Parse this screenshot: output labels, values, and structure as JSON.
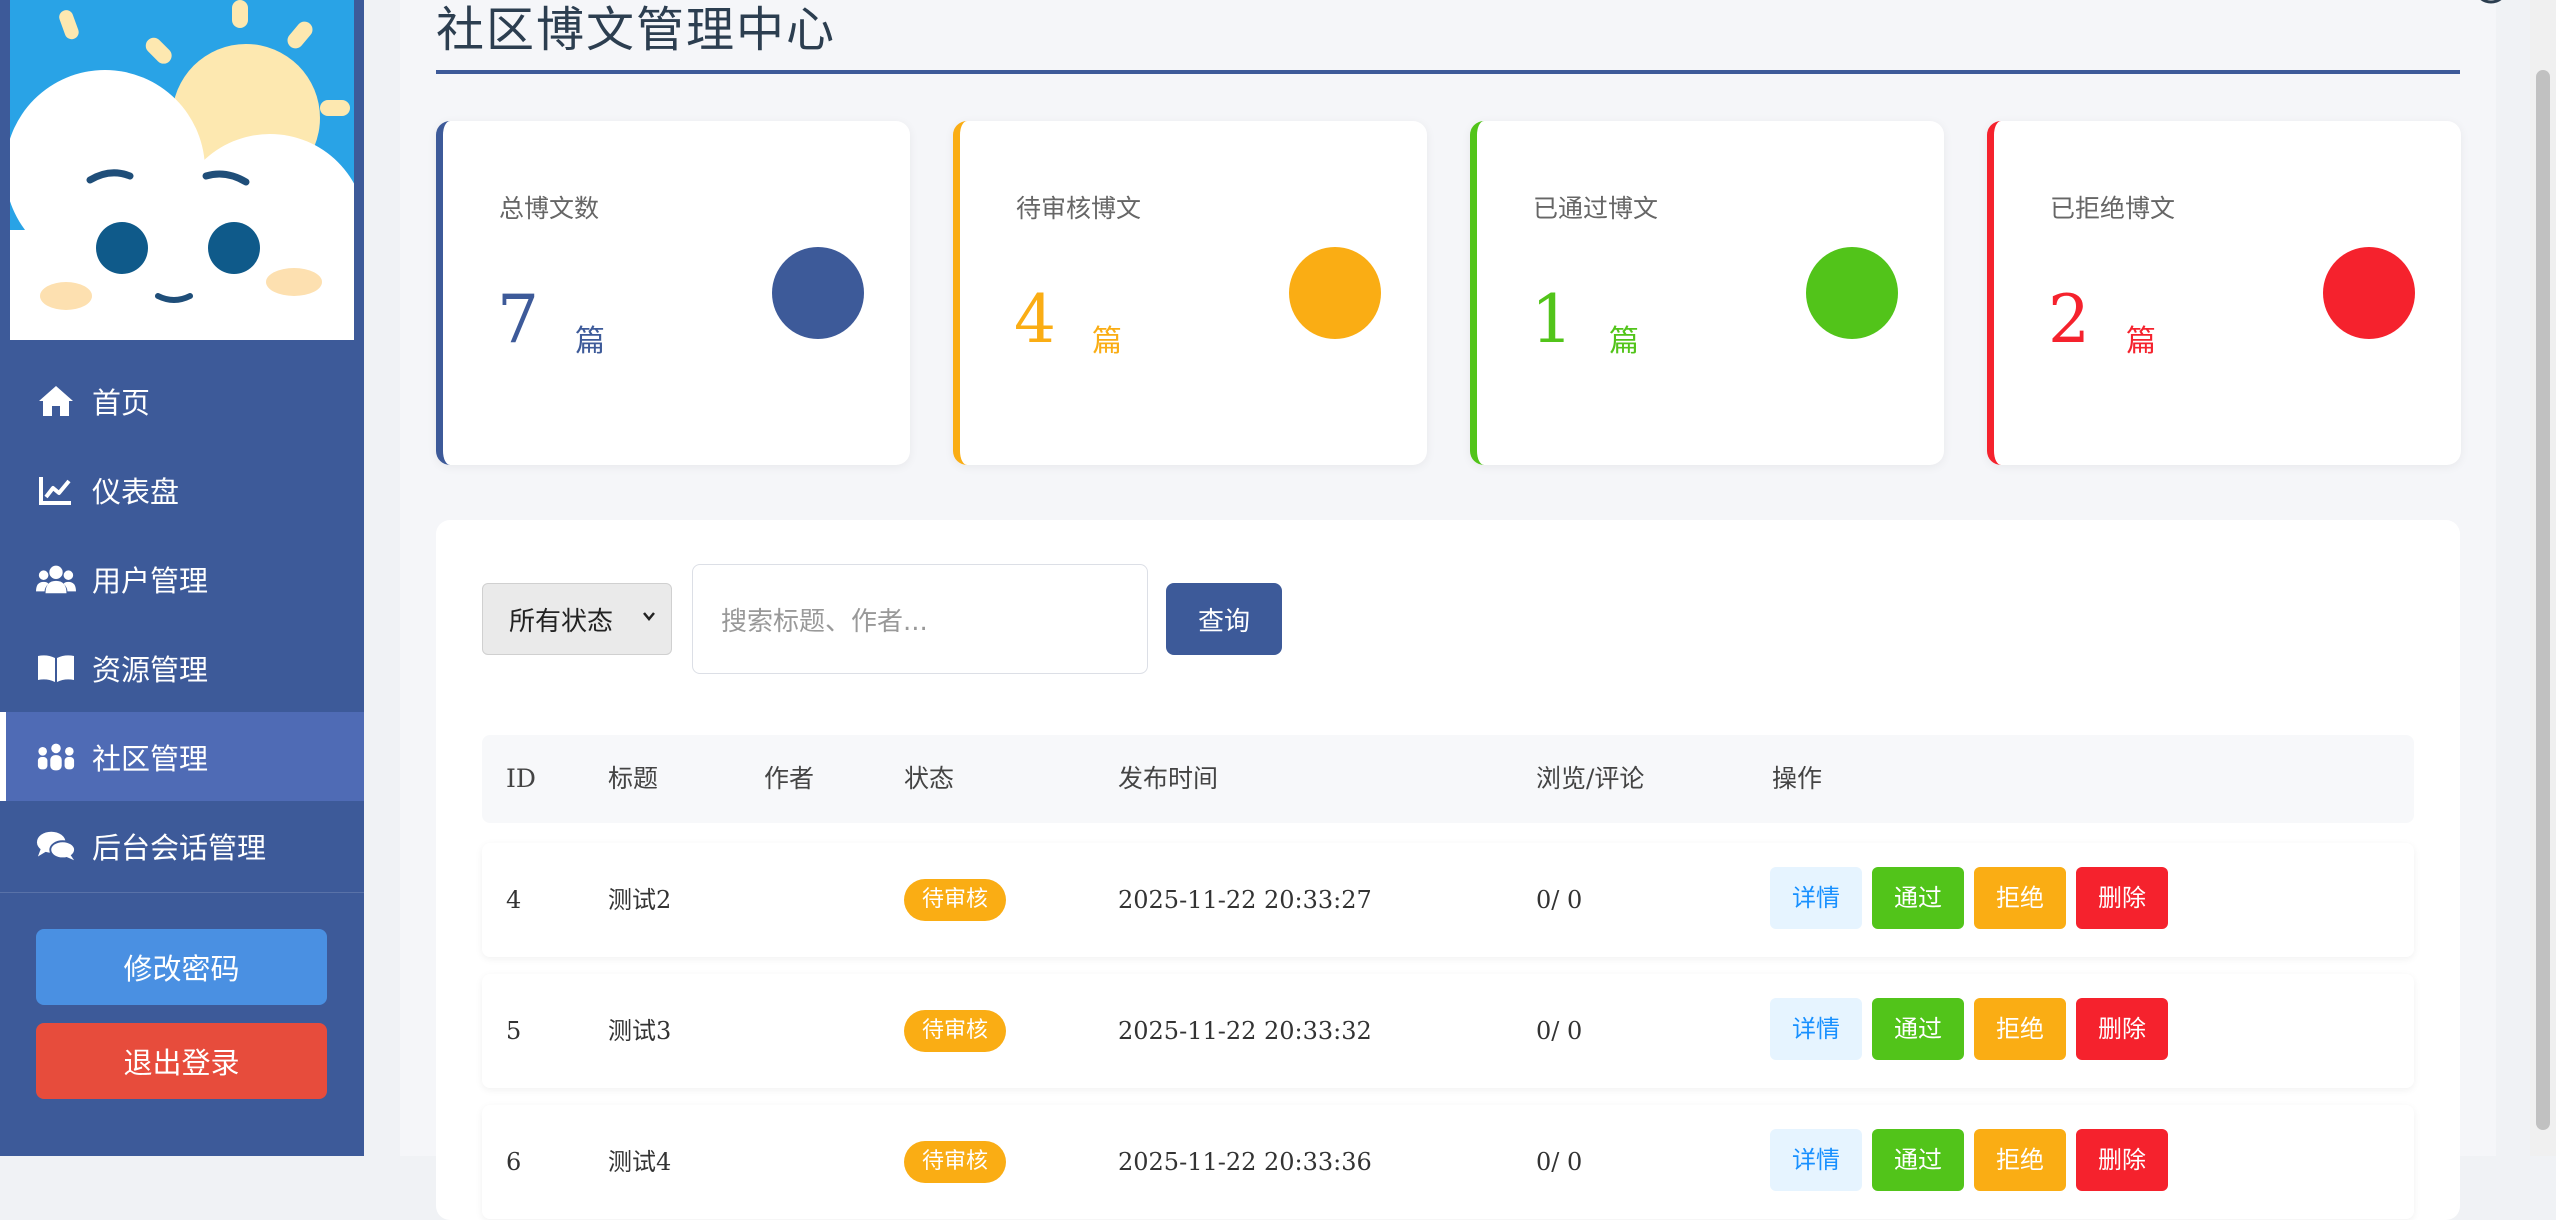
{
  "colors": {
    "sidebar_bg": "#3d5a99",
    "primary": "#3d5a99",
    "pending": "#faad14",
    "approved": "#52c41a",
    "rejected": "#f5222d",
    "change_password": "#4a90e2",
    "logout": "#e74c3c"
  },
  "sidebar": {
    "items": [
      {
        "label": "首页",
        "icon": "home-icon",
        "active": false
      },
      {
        "label": "仪表盘",
        "icon": "chart-line-icon",
        "active": false
      },
      {
        "label": "用户管理",
        "icon": "users-icon",
        "active": false
      },
      {
        "label": "资源管理",
        "icon": "book-icon",
        "active": false
      },
      {
        "label": "社区管理",
        "icon": "people-group-icon",
        "active": true
      },
      {
        "label": "后台会话管理",
        "icon": "comments-icon",
        "active": false
      }
    ],
    "change_password_label": "修改密码",
    "logout_label": "退出登录"
  },
  "header": {
    "title": "社区博文管理中心"
  },
  "stats": [
    {
      "label": "总博文数",
      "value": "7",
      "unit": "篇",
      "color": "#3d5a99"
    },
    {
      "label": "待审核博文",
      "value": "4",
      "unit": "篇",
      "color": "#faad14"
    },
    {
      "label": "已通过博文",
      "value": "1",
      "unit": "篇",
      "color": "#52c41a"
    },
    {
      "label": "已拒绝博文",
      "value": "2",
      "unit": "篇",
      "color": "#f5222d"
    }
  ],
  "filter": {
    "status_selected": "所有状态",
    "search_placeholder": "搜索标题、作者...",
    "search_button": "查询"
  },
  "table": {
    "columns": [
      "ID",
      "标题",
      "作者",
      "状态",
      "发布时间",
      "浏览/评论",
      "操作"
    ],
    "rows": [
      {
        "id": "4",
        "title": "测试2",
        "author": "",
        "status": "待审核",
        "time": "2025-11-22 20:33:27",
        "views": "0/ 0"
      },
      {
        "id": "5",
        "title": "测试3",
        "author": "",
        "status": "待审核",
        "time": "2025-11-22 20:33:32",
        "views": "0/ 0"
      },
      {
        "id": "6",
        "title": "测试4",
        "author": "",
        "status": "待审核",
        "time": "2025-11-22 20:33:36",
        "views": "0/ 0"
      }
    ],
    "actions": {
      "detail": "详情",
      "approve": "通过",
      "reject": "拒绝",
      "delete": "删除"
    }
  }
}
